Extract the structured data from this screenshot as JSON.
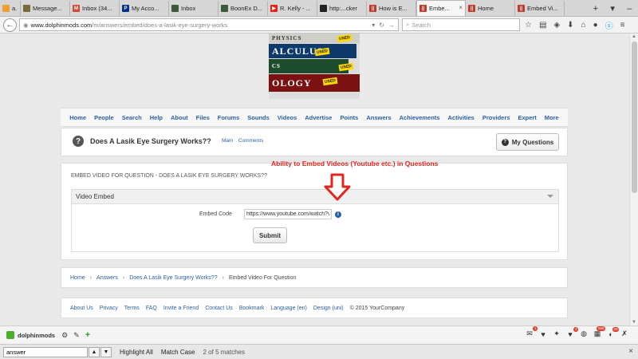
{
  "browser": {
    "tabs": [
      {
        "label": "a...",
        "favicon_color": "#f0a030",
        "favicon": ""
      },
      {
        "label": "Message...",
        "favicon_color": "#7a6a3a",
        "favicon": ""
      },
      {
        "label": "Inbox (34...",
        "favicon_color": "#d44638",
        "favicon": "M"
      },
      {
        "label": "My Acco...",
        "favicon_color": "#003087",
        "favicon": "P"
      },
      {
        "label": "Inbox",
        "favicon_color": "#3a5a3a",
        "favicon": ""
      },
      {
        "label": "BoonEx D...",
        "favicon_color": "#3a5a3a",
        "favicon": ""
      },
      {
        "label": "R. Kelly - ...",
        "favicon_color": "#e62117",
        "favicon": "▶"
      },
      {
        "label": "http:...cker",
        "favicon_color": "#222222",
        "favicon": ""
      },
      {
        "label": "How is E...",
        "favicon_color": "#c0392b",
        "favicon": "||"
      },
      {
        "label": "Embe...",
        "favicon_color": "#c0392b",
        "favicon": "||"
      },
      {
        "label": "Home",
        "favicon_color": "#c0392b",
        "favicon": "||"
      },
      {
        "label": "Embed Vi...",
        "favicon_color": "#c0392b",
        "favicon": "||"
      }
    ],
    "active_tab_index": 9,
    "controls": {
      "new_tab": "+",
      "list": "▾",
      "minimize": "–"
    },
    "url_host": "www.dolphinmods.com",
    "url_path": "/m/answers/embed/does-a-lasik-eye-surgery-works",
    "search_placeholder": "Search"
  },
  "banner": {
    "books": [
      "PHYSICS",
      "ALCULUS",
      "CS",
      "OLOGY"
    ],
    "tag": "USED"
  },
  "site_nav": [
    "Home",
    "People",
    "Search",
    "Help",
    "About",
    "Files",
    "Forums",
    "Sounds",
    "Videos",
    "Advertise",
    "Points",
    "Answers",
    "Achievements",
    "Activities",
    "Providers",
    "Expert",
    "More"
  ],
  "question": {
    "icon": "?",
    "title": "Does A Lasik Eye Surgery Works??",
    "links": [
      "Main",
      "Comments"
    ],
    "my_questions_label": "My Questions"
  },
  "annotation": "Ability to Embed Videos (Youtube etc.) in Questions",
  "embed_form": {
    "heading": "EMBED VIDEO FOR QUESTION - DOES A LASIK EYE SURGERY WORKS??",
    "fieldset_title": "Video Embed",
    "field_label": "Embed Code",
    "field_value": "https://www.youtube.com/watch?v=O",
    "submit_label": "Submit"
  },
  "breadcrumb": {
    "links": [
      "Home",
      "Answers",
      "Does A Lasik Eye Surgery Works??"
    ],
    "current": "Embed Video For Question",
    "separator": "›"
  },
  "footer": {
    "links": [
      "About Us",
      "Privacy",
      "Terms",
      "FAQ",
      "Invite a Friend",
      "Contact Us",
      "Bookmark",
      "Language (en)",
      "Design (uni)"
    ],
    "copyright": "© 2015 YourCompany"
  },
  "appbar": {
    "site_name": "dolphinmods",
    "notifications": {
      "mail": "1",
      "likes": "2",
      "friends": "565",
      "alerts": "20"
    }
  },
  "findbar": {
    "query": "answer",
    "highlight_label": "Highlight All",
    "match_case_label": "Match Case",
    "status": "2 of 5 matches"
  }
}
